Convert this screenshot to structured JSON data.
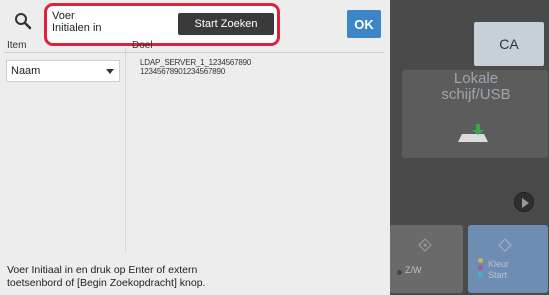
{
  "dialog": {
    "prompt_line1": "Voer",
    "prompt_line2": "Initialen in",
    "start_button": "Start Zoeken",
    "ok_button": "OK",
    "col_item": "Item",
    "col_target": "Doel",
    "item_selected": "Naam",
    "target_line1": "LDAP_SERVER_1_1234567890",
    "target_line2": "12345678901234567890",
    "hint_line1": "Voer Initiaal in en druk op Enter of extern",
    "hint_line2": "toetsenbord of [Begin Zoekopdracht] knop."
  },
  "background": {
    "ca_label": "CA",
    "tile_label_line1": "Lokale",
    "tile_label_line2": "schijf/USB",
    "zw_label": "Z/W",
    "kleur_line1": "Kleur",
    "kleur_line2": "Start"
  },
  "colors": {
    "highlight": "#e0203c",
    "ok_blue": "#3c86c8",
    "start_dark": "#3a3a3a"
  }
}
